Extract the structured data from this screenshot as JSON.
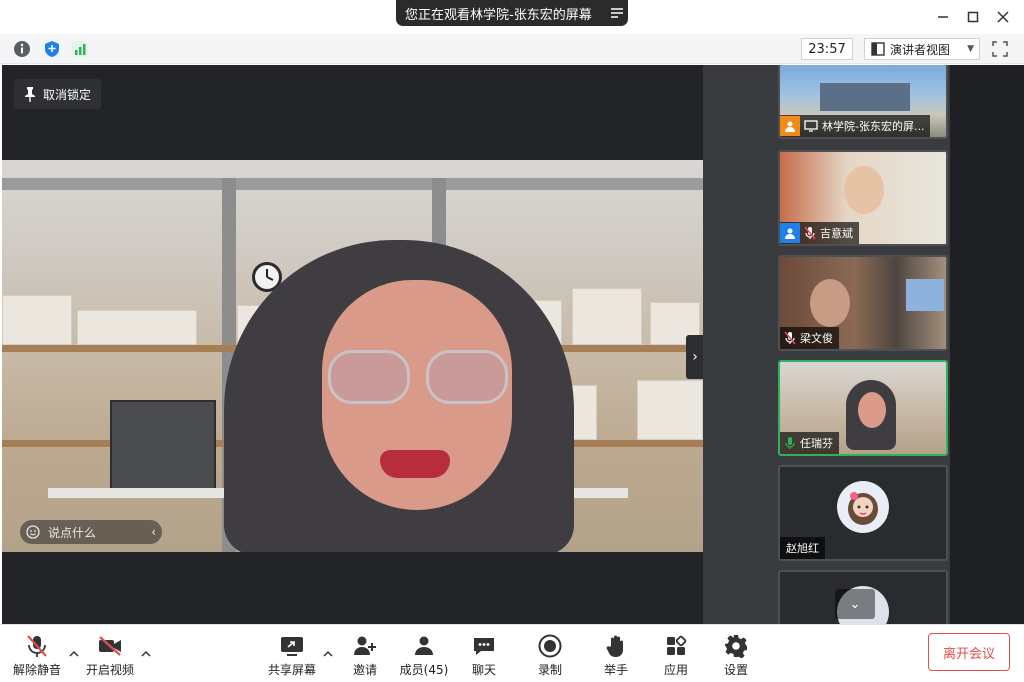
{
  "window": {
    "title": "您正在观看林学院-张东宏的屏幕"
  },
  "infobar": {
    "time": "23:57",
    "view_mode": "演讲者视图"
  },
  "main": {
    "unpin_label": "取消锁定",
    "chat_placeholder": "说点什么"
  },
  "participants": [
    {
      "name": "林学院-张东宏的屏...",
      "badge": "orange",
      "type": "screen-share"
    },
    {
      "name": "吉意斌",
      "badge": "blue",
      "type": "video",
      "mic": "muted"
    },
    {
      "name": "梁文俊",
      "type": "video",
      "mic": "muted"
    },
    {
      "name": "任瑞芬",
      "type": "video",
      "mic": "speaking",
      "active": true
    },
    {
      "name": "赵旭红",
      "type": "avatar"
    }
  ],
  "toolbar": {
    "unmute": "解除静音",
    "start_video": "开启视频",
    "share_screen": "共享屏幕",
    "invite": "邀请",
    "members": "成员(45)",
    "chat": "聊天",
    "record": "录制",
    "raise_hand": "举手",
    "apps": "应用",
    "settings": "设置",
    "leave": "离开会议"
  },
  "colors": {
    "accent_green": "#2fb25a",
    "leave_red": "#e0504b",
    "share_orange": "#f28a16",
    "user_blue": "#1e80ea",
    "stage_bg": "#232428"
  }
}
